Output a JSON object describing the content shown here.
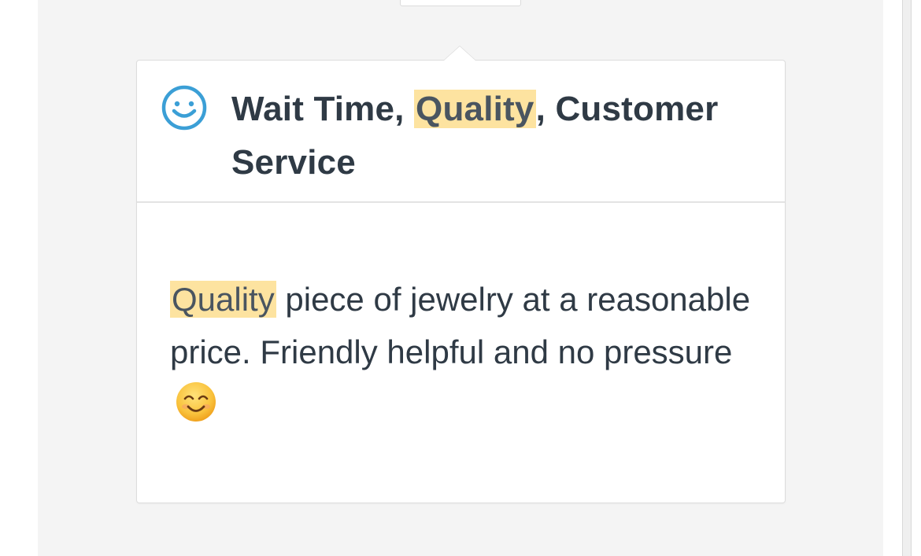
{
  "review_card": {
    "topics": [
      "Wait Time",
      "Quality",
      "Customer Service"
    ],
    "topic_separator": ", ",
    "highlighted_term": "Quality",
    "sentiment_icon": "smile-icon",
    "review_text_highlight": "Quality",
    "review_text_rest": " piece of jewelry at a reasonable price. Friendly helpful and no pressure",
    "review_emoji": "smiling-face-with-smiling-eyes",
    "highlight_color": "#fde3a0",
    "icon_color": "#3b9fd6"
  }
}
